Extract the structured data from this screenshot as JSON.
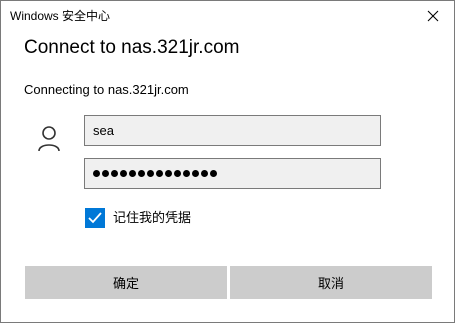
{
  "titlebar": {
    "title": "Windows 安全中心",
    "close_icon": "close-icon"
  },
  "dialog": {
    "heading": "Connect to nas.321jr.com",
    "subtext": "Connecting to nas.321jr.com"
  },
  "credentials": {
    "user_icon": "user-icon",
    "username_value": "sea",
    "password_masked_length": 14
  },
  "remember": {
    "label": "记住我的凭据",
    "checked": true,
    "accent": "#0078d7"
  },
  "buttons": {
    "ok_label": "确定",
    "cancel_label": "取消"
  }
}
